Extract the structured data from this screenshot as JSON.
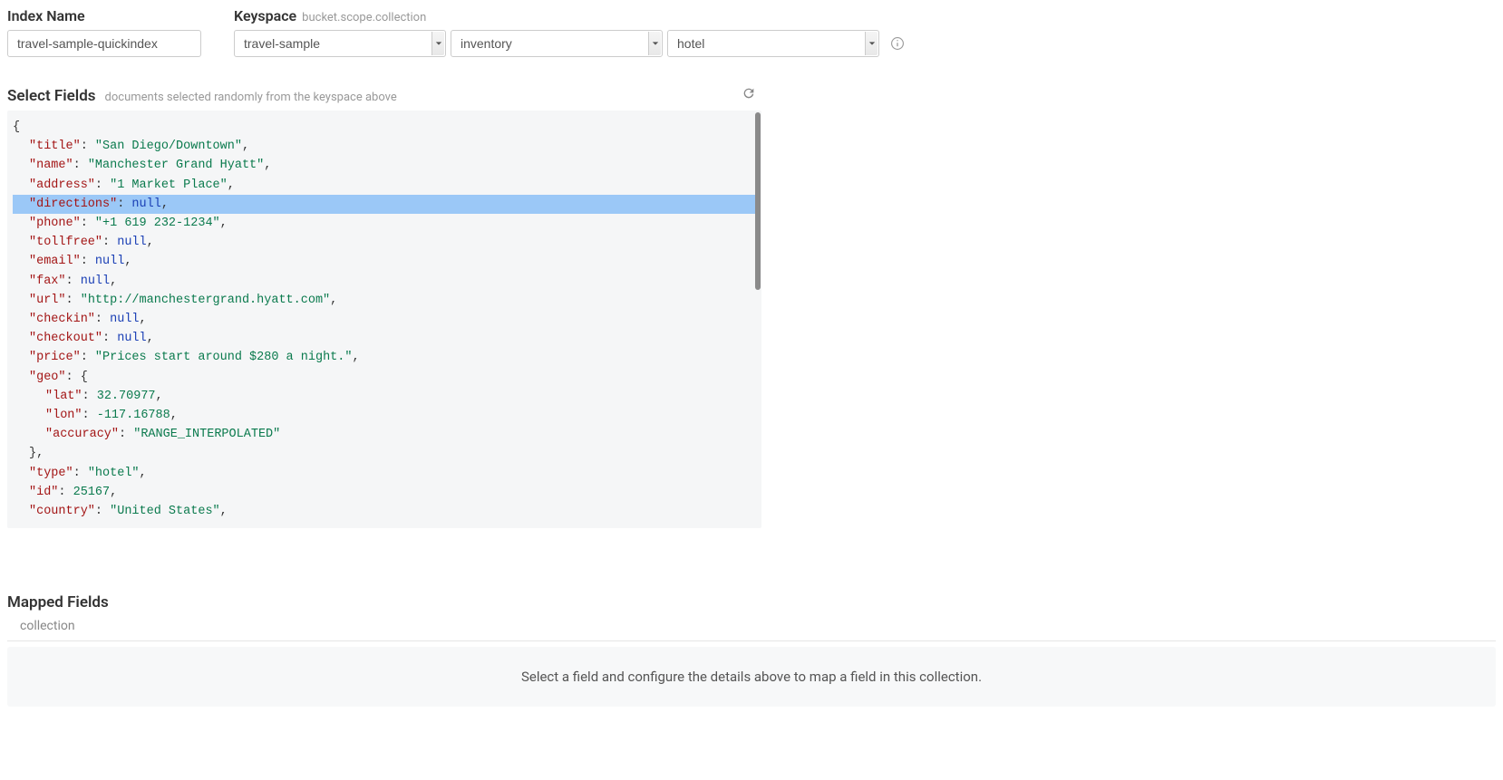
{
  "indexName": {
    "label": "Index Name",
    "value": "travel-sample-quickindex"
  },
  "keyspace": {
    "label": "Keyspace",
    "hint": "bucket.scope.collection",
    "bucket": "travel-sample",
    "scope": "inventory",
    "collection": "hotel"
  },
  "selectFields": {
    "title": "Select Fields",
    "hint": "documents selected randomly from the keyspace above"
  },
  "document": {
    "lines": [
      {
        "raw": "{",
        "indent": 0
      },
      {
        "key": "title",
        "valType": "string",
        "val": "San Diego/Downtown",
        "comma": true,
        "indent": 1
      },
      {
        "key": "name",
        "valType": "string",
        "val": "Manchester Grand Hyatt",
        "comma": true,
        "indent": 1
      },
      {
        "key": "address",
        "valType": "string",
        "val": "1 Market Place",
        "comma": true,
        "indent": 1
      },
      {
        "key": "directions",
        "valType": "null",
        "val": "null",
        "comma": true,
        "indent": 1,
        "highlight": true
      },
      {
        "key": "phone",
        "valType": "string",
        "val": "+1 619 232-1234",
        "comma": true,
        "indent": 1
      },
      {
        "key": "tollfree",
        "valType": "null",
        "val": "null",
        "comma": true,
        "indent": 1
      },
      {
        "key": "email",
        "valType": "null",
        "val": "null",
        "comma": true,
        "indent": 1
      },
      {
        "key": "fax",
        "valType": "null",
        "val": "null",
        "comma": true,
        "indent": 1
      },
      {
        "key": "url",
        "valType": "string",
        "val": "http://manchestergrand.hyatt.com",
        "comma": true,
        "indent": 1
      },
      {
        "key": "checkin",
        "valType": "null",
        "val": "null",
        "comma": true,
        "indent": 1
      },
      {
        "key": "checkout",
        "valType": "null",
        "val": "null",
        "comma": true,
        "indent": 1
      },
      {
        "key": "price",
        "valType": "string",
        "val": "Prices start around $280 a night.",
        "comma": true,
        "indent": 1
      },
      {
        "key": "geo",
        "valType": "open",
        "val": "{",
        "indent": 1
      },
      {
        "key": "lat",
        "valType": "number",
        "val": "32.70977",
        "comma": true,
        "indent": 2
      },
      {
        "key": "lon",
        "valType": "number",
        "val": "-117.16788",
        "comma": true,
        "indent": 2
      },
      {
        "key": "accuracy",
        "valType": "string",
        "val": "RANGE_INTERPOLATED",
        "indent": 2
      },
      {
        "raw": "},",
        "indent": 1
      },
      {
        "key": "type",
        "valType": "string",
        "val": "hotel",
        "comma": true,
        "indent": 1
      },
      {
        "key": "id",
        "valType": "number",
        "val": "25167",
        "comma": true,
        "indent": 1
      },
      {
        "key": "country",
        "valType": "string",
        "val": "United States",
        "comma": true,
        "indent": 1
      }
    ]
  },
  "mapped": {
    "title": "Mapped Fields",
    "sub": "collection",
    "empty": "Select a field and configure the details above to map a field in this collection."
  }
}
